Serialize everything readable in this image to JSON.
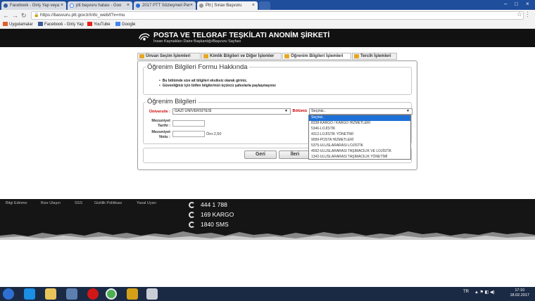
{
  "browser": {
    "tabs": [
      {
        "label": "Facebook - Giriş Yap veya",
        "favicon_color": "#3b5998"
      },
      {
        "label": "ptt başvuru hatası - Goo",
        "favicon_color": "#ffffff"
      },
      {
        "label": "2017 PTT Sözleşmeli Per",
        "favicon_color": "#2a6ecf"
      },
      {
        "label": "Ptt | Sınav Başvuru",
        "favicon_color": "#999999"
      }
    ],
    "address": "https://basvuru.ptt.gov.tr/info_web/t?x=mu",
    "bookmarks": [
      {
        "label": "Uygulamalar",
        "icon": "apps-icon",
        "color": "#e0602a"
      },
      {
        "label": "Facebook - Giriş Yap",
        "icon": "facebook-icon",
        "color": "#3b5998"
      },
      {
        "label": "YouTube",
        "icon": "youtube-icon",
        "color": "#e62117"
      },
      {
        "label": "Google",
        "icon": "google-icon",
        "color": "#4285f4"
      }
    ]
  },
  "header": {
    "company": "POSTA VE TELGRAF TEŞKİLATI ANONİM ŞİRKETİ",
    "subtitle": "İnsan Kaynakları Daire Başkanlığı/Başvuru Sayfası"
  },
  "steps": [
    {
      "label": "Ünvan Seçim İşlemleri"
    },
    {
      "label": "Kimlik Bilgileri ve Diğer İşlemler"
    },
    {
      "label": "Öğrenim Bilgileri İşlemleri"
    },
    {
      "label": "Tercih İşlemleri"
    }
  ],
  "about": {
    "title": "Öğrenim Bilgileri Formu Hakkında",
    "items": [
      "Bu bölümde size ait bilgileri eksiksiz olarak giriniz.",
      "Güvenliğiniz için lütfen bilgilerinizi üçüncü şahıslarla paylaşmayınız"
    ]
  },
  "form": {
    "title": "Öğrenim Bilgileri",
    "university_label": "Üniversite :",
    "university_value": "GAZİ ÜNİVERSİTESİ",
    "department_label": "Bölümü",
    "department_value": "Seçiniz..",
    "grad_date_label_1": "Mezuniyet",
    "grad_date_label_2": "Tarihi :",
    "grad_grade_label_1": "Mezuniyet",
    "grad_grade_label_2": "Notu :",
    "grade_hint": "Örn:2,50",
    "department_options": [
      "Seçiniz..",
      "8338-KARGO / KARGO HİZMETLERİ",
      "5346-LOJİSTİK",
      "4312-LOJİSTİK YÖNETİMİ",
      "9099-POSTA HİZMETLERİ",
      "5375-ULUSLARARASI LOJİSTİK",
      "4592-ULUSLARARASI TAŞIMACILIK VE LOJİSTİK",
      "1342-ULUSLARARASI TAŞIMACILIK YÖNETİMİ"
    ],
    "back_label": "Geri",
    "next_label": "İleri"
  },
  "footer": {
    "links": [
      "Bilgi Edinme",
      "Bize Ulaşın",
      "SSS",
      "Gizlilik Politikası",
      "Yasal Uyarı"
    ],
    "phones": [
      "444 1 788",
      "169 KARGO",
      "1840  SMS"
    ]
  },
  "taskbar": {
    "lang": "TR",
    "time": "17:10",
    "date": "18.02.2017"
  }
}
